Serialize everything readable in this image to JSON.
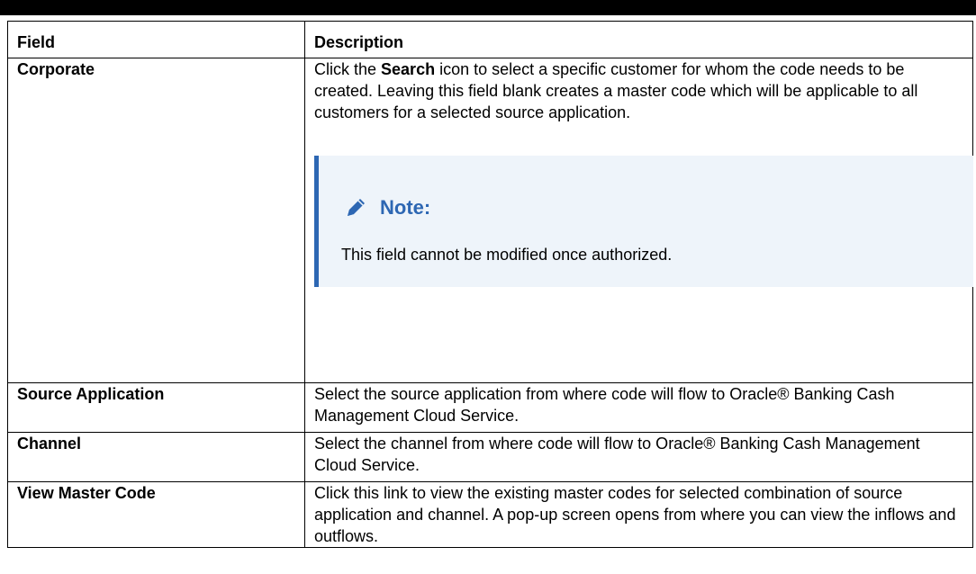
{
  "table": {
    "headers": {
      "field": "Field",
      "description": "Description"
    },
    "rows": [
      {
        "field": "Corporate",
        "desc_parts": {
          "before": "Click the ",
          "bold": "Search",
          "after": " icon to select a specific customer for whom the code needs to be created. Leaving this field blank creates a master code which will be applicable to all customers for a selected source application."
        },
        "note": {
          "icon": "pencil-icon",
          "title": "Note:",
          "text": "This field cannot be modified once authorized."
        }
      },
      {
        "field": "Source Application",
        "desc": "Select the source application from where code will flow to Oracle® Banking Cash Management Cloud Service."
      },
      {
        "field": "Channel",
        "desc": "Select the channel from where code will flow to Oracle® Banking Cash Management Cloud Service."
      },
      {
        "field": "View Master Code",
        "desc": "Click this link to view the existing master codes for selected combination of source application and channel. A pop-up screen opens from where you can view the inflows and outflows."
      }
    ]
  },
  "colors": {
    "note_accent": "#2d67b3",
    "note_background": "#eef4fa"
  }
}
